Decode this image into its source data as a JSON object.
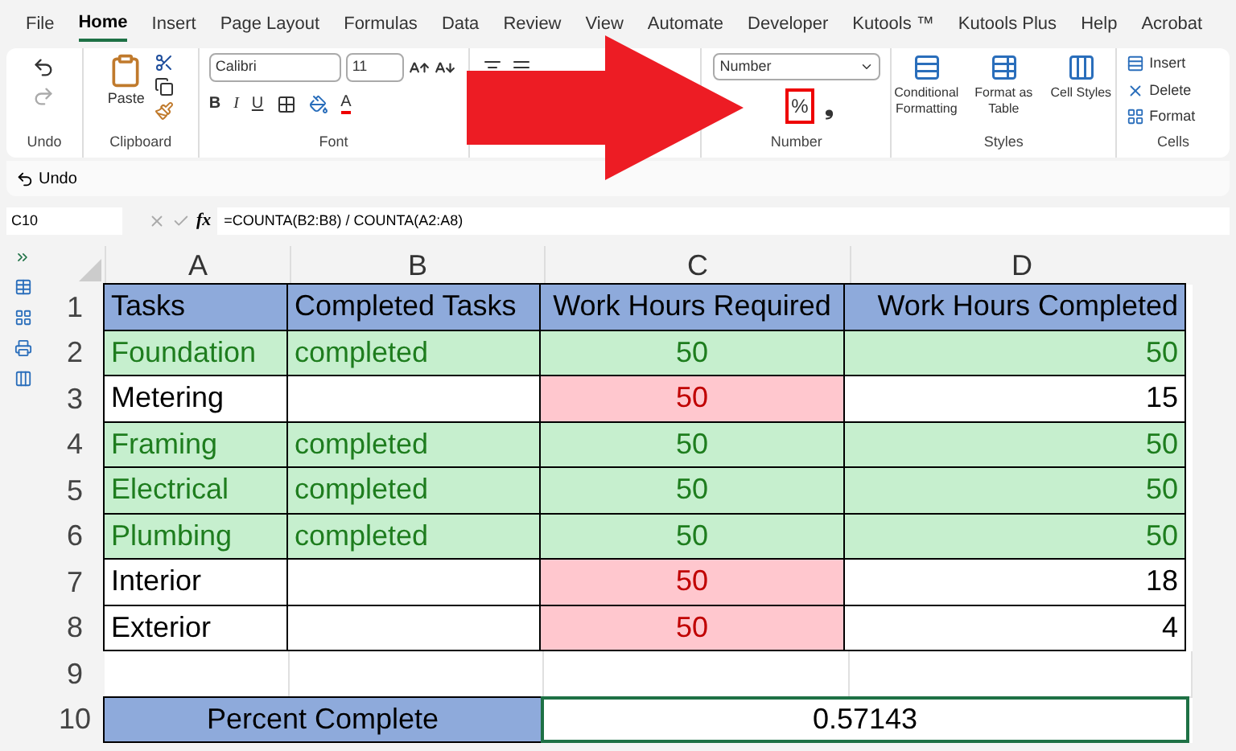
{
  "tabs": [
    {
      "label": "File",
      "selected": false
    },
    {
      "label": "Home",
      "selected": true
    },
    {
      "label": "Insert",
      "selected": false
    },
    {
      "label": "Page Layout",
      "selected": false
    },
    {
      "label": "Formulas",
      "selected": false
    },
    {
      "label": "Data",
      "selected": false
    },
    {
      "label": "Review",
      "selected": false
    },
    {
      "label": "View",
      "selected": false
    },
    {
      "label": "Automate",
      "selected": false
    },
    {
      "label": "Developer",
      "selected": false
    },
    {
      "label": "Kutools ™",
      "selected": false
    },
    {
      "label": "Kutools Plus",
      "selected": false
    },
    {
      "label": "Help",
      "selected": false
    },
    {
      "label": "Acrobat",
      "selected": false
    }
  ],
  "ribbon": {
    "undo_group": "Undo",
    "clipboard": {
      "paste": "Paste",
      "group": "Clipboard"
    },
    "font": {
      "name": "Calibri",
      "size": "11",
      "bold": "B",
      "italic": "I",
      "underline": "U",
      "font_color": "A",
      "group": "Font"
    },
    "number": {
      "format": "Number",
      "percent": "%",
      "comma": "❟",
      "group": "Number",
      "percent_highlighted": true
    },
    "styles": {
      "items": [
        {
          "label": "Conditional Formatting",
          "kind": "conditional"
        },
        {
          "label": "Format as Table",
          "kind": "table"
        },
        {
          "label": "Cell Styles",
          "kind": "cellstyle"
        }
      ],
      "group": "Styles"
    },
    "cells": {
      "items": [
        {
          "label": "Insert",
          "kind": "insert"
        },
        {
          "label": "Delete",
          "kind": "delete"
        },
        {
          "label": "Format",
          "kind": "format"
        }
      ],
      "group": "Cells"
    }
  },
  "quick_access": {
    "undo": "Undo"
  },
  "formula_bar": {
    "name_box": "C10",
    "fx": "fx",
    "formula": "=COUNTA(B2:B8) / COUNTA(A2:A8)"
  },
  "sheet": {
    "columns": [
      {
        "label": "A"
      },
      {
        "label": "B"
      },
      {
        "label": "C"
      },
      {
        "label": "D"
      }
    ],
    "rows": [
      {
        "number": "1",
        "cells": [
          {
            "text": "Tasks",
            "kind": "header"
          },
          {
            "text": "Completed Tasks",
            "kind": "header"
          },
          {
            "text": "Work Hours Required",
            "kind": "header"
          },
          {
            "text": "Work Hours Completed",
            "kind": "header"
          }
        ]
      },
      {
        "number": "2",
        "cells": [
          {
            "text": "Foundation",
            "kind": "done"
          },
          {
            "text": "completed",
            "kind": "done"
          },
          {
            "text": "50",
            "kind": "done"
          },
          {
            "text": "50",
            "kind": "done"
          }
        ]
      },
      {
        "number": "3",
        "cells": [
          {
            "text": "Metering",
            "kind": "plain"
          },
          {
            "kind": "plain"
          },
          {
            "text": "50",
            "kind": "late"
          },
          {
            "text": "15",
            "kind": "plain"
          }
        ]
      },
      {
        "number": "4",
        "cells": [
          {
            "text": "Framing",
            "kind": "done"
          },
          {
            "text": "completed",
            "kind": "done"
          },
          {
            "text": "50",
            "kind": "done"
          },
          {
            "text": "50",
            "kind": "done"
          }
        ]
      },
      {
        "number": "5",
        "cells": [
          {
            "text": "Electrical",
            "kind": "done"
          },
          {
            "text": "completed",
            "kind": "done"
          },
          {
            "text": "50",
            "kind": "done"
          },
          {
            "text": "50",
            "kind": "done"
          }
        ]
      },
      {
        "number": "6",
        "cells": [
          {
            "text": "Plumbing",
            "kind": "done"
          },
          {
            "text": "completed",
            "kind": "done"
          },
          {
            "text": "50",
            "kind": "done"
          },
          {
            "text": "50",
            "kind": "done"
          }
        ]
      },
      {
        "number": "7",
        "cells": [
          {
            "text": "Interior",
            "kind": "plain"
          },
          {
            "kind": "plain"
          },
          {
            "text": "50",
            "kind": "late"
          },
          {
            "text": "18",
            "kind": "plain"
          }
        ]
      },
      {
        "number": "8",
        "cells": [
          {
            "text": "Exterior",
            "kind": "plain"
          },
          {
            "kind": "plain"
          },
          {
            "text": "50",
            "kind": "late"
          },
          {
            "text": "4",
            "kind": "plain"
          }
        ]
      },
      {
        "number": "9",
        "cells": [
          {
            "kind": "empty"
          },
          {
            "kind": "empty"
          },
          {
            "kind": "empty"
          },
          {
            "kind": "empty"
          }
        ]
      },
      {
        "number": "10",
        "kind": "summary",
        "cells": [
          {
            "text": "Percent Complete",
            "kind": "header",
            "selected": false
          },
          {
            "text": "0.57143",
            "kind": "plain",
            "selected": true
          }
        ]
      }
    ]
  }
}
